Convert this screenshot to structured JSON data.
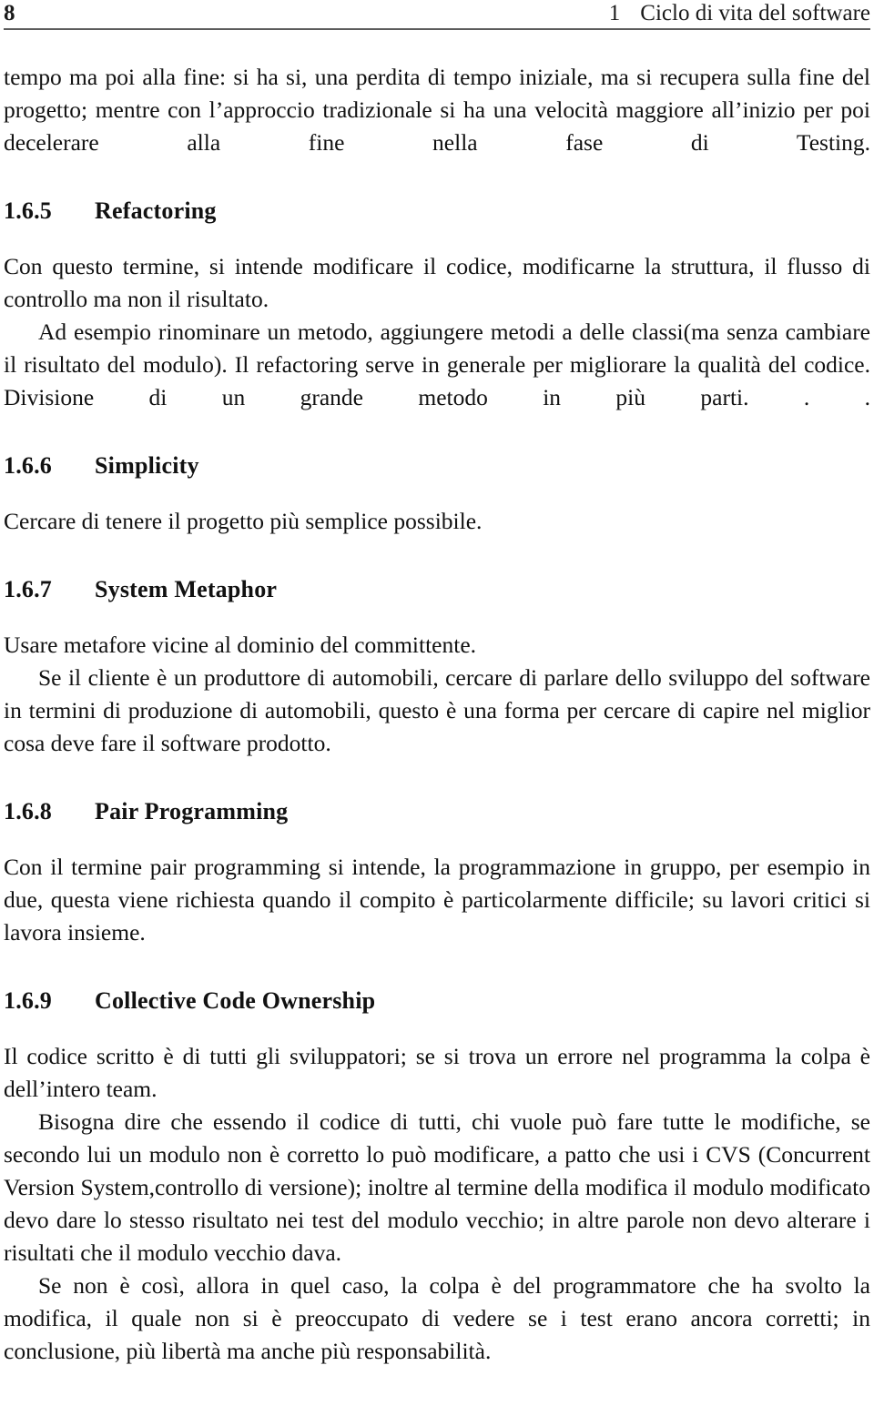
{
  "running_head": {
    "folio": "8",
    "chapter_number": "1",
    "chapter_title": "Ciclo di vita del software"
  },
  "intro": {
    "paragraph": "tempo ma poi alla fine: si ha si, una perdita di tempo iniziale, ma si recupera sulla fine del progetto; mentre con l’approccio tradizionale si ha una velocità maggiore all’inizio per poi decelerare alla fine nella fase di Testing."
  },
  "sections": [
    {
      "number": "1.6.5",
      "title": "Refactoring",
      "paragraphs": [
        "Con questo termine, si intende modificare il codice, modificarne la struttura, il flusso di controllo ma non il risultato.",
        "Ad esempio rinominare un metodo, aggiungere metodi a delle classi(ma senza cambiare il risultato del modulo). Il refactoring serve in generale per migliorare la qualità del codice. Divisione di un grande metodo in più parti. . ."
      ]
    },
    {
      "number": "1.6.6",
      "title": "Simplicity",
      "paragraphs": [
        "Cercare di tenere il progetto più semplice possibile."
      ]
    },
    {
      "number": "1.6.7",
      "title": "System Metaphor",
      "paragraphs": [
        "Usare metafore vicine al dominio del committente.",
        "Se il cliente è un produttore di automobili, cercare di parlare dello sviluppo del software in termini di produzione di automobili, questo è una forma per cercare di capire nel miglior cosa deve fare il software prodotto."
      ]
    },
    {
      "number": "1.6.8",
      "title": "Pair Programming",
      "paragraphs": [
        "Con il termine pair programming si intende, la programmazione in gruppo, per esempio in due, questa viene richiesta quando il compito è particolarmente difficile; su lavori critici si lavora insieme."
      ]
    },
    {
      "number": "1.6.9",
      "title": "Collective Code Ownership",
      "paragraphs": [
        "Il codice scritto è di tutti gli sviluppatori; se si trova un errore nel programma la colpa è dell’intero team.",
        "Bisogna dire che essendo il codice di tutti, chi vuole può fare tutte le modifiche, se secondo lui un modulo non è corretto lo può modificare, a patto che usi i CVS (Concurrent Version System,controllo di versione); inoltre al termine della modifica il modulo modificato devo dare lo stesso risultato nei test del modulo vecchio; in altre parole non devo alterare i risultati che il modulo vecchio dava.",
        "Se non è così, allora in quel caso, la colpa è del programmatore che ha svolto la modifica, il quale non si è preoccupato di vedere se i test erano ancora corretti; in conclusione, più libertà ma anche più responsabilità."
      ]
    }
  ]
}
